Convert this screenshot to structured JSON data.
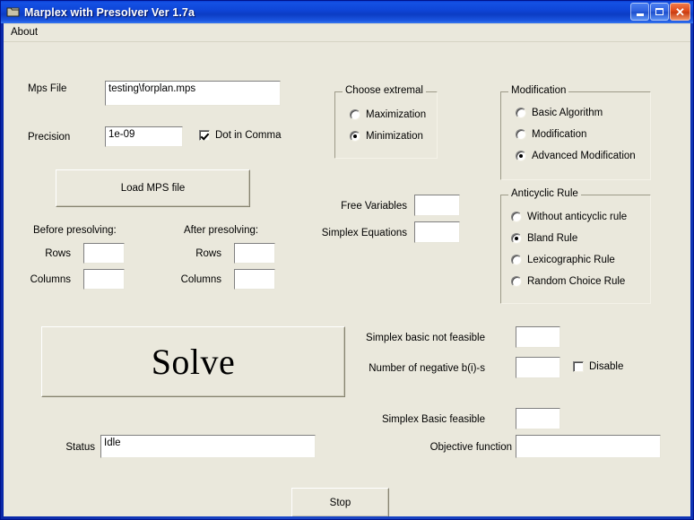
{
  "window": {
    "title": "Marplex with Presolver Ver 1.7a",
    "icon": "app-window-icon",
    "minimize_label": "",
    "maximize_label": "",
    "close_label": "✕"
  },
  "menubar": {
    "items": [
      {
        "label": "About"
      }
    ]
  },
  "form": {
    "mps_file": {
      "label": "Mps File",
      "value": "testing\\forplan.mps"
    },
    "precision": {
      "label": "Precision",
      "value": "1e-09"
    },
    "dot_in_comma": {
      "label": "Dot in Comma",
      "checked": true
    },
    "load_mps_button": {
      "label": "Load MPS file"
    },
    "before_presolving": {
      "title": "Before presolving:",
      "rows_label": "Rows",
      "rows_value": "",
      "columns_label": "Columns",
      "columns_value": ""
    },
    "after_presolving": {
      "title": "After presolving:",
      "rows_label": "Rows",
      "rows_value": "",
      "columns_label": "Columns",
      "columns_value": ""
    },
    "choose_extremal": {
      "title": "Choose extremal",
      "options": [
        {
          "label": "Maximization",
          "selected": false
        },
        {
          "label": "Minimization",
          "selected": true
        }
      ]
    },
    "modification": {
      "title": "Modification",
      "options": [
        {
          "label": "Basic Algorithm",
          "selected": false
        },
        {
          "label": "Modification",
          "selected": false
        },
        {
          "label": "Advanced Modification",
          "selected": true
        }
      ]
    },
    "anticyclic_rule": {
      "title": "Anticyclic Rule",
      "options": [
        {
          "label": "Without anticyclic rule",
          "selected": false
        },
        {
          "label": "Bland Rule",
          "selected": true
        },
        {
          "label": "Lexicographic Rule",
          "selected": false
        },
        {
          "label": "Random Choice Rule",
          "selected": false
        }
      ]
    },
    "free_variables": {
      "label": "Free Variables",
      "value": ""
    },
    "simplex_equations": {
      "label": "Simplex Equations",
      "value": ""
    },
    "solve_button": {
      "label": "Solve"
    },
    "status": {
      "label": "Status",
      "value": "Idle"
    },
    "simplex_basic_not_feasible": {
      "label": "Simplex basic not feasible",
      "value": ""
    },
    "number_of_negative_b": {
      "label": "Number of negative b(i)-s",
      "value": ""
    },
    "disable": {
      "label": "Disable",
      "checked": false
    },
    "simplex_basic_feasible": {
      "label": "Simplex Basic feasible",
      "value": ""
    },
    "objective_function": {
      "label": "Objective function",
      "value": ""
    },
    "stop_button": {
      "label": "Stop"
    }
  },
  "colors": {
    "form_background": "#eae8dc",
    "title_bar": "#0f46d8",
    "close_button": "#e04a1a",
    "field_background": "#ffffff"
  }
}
